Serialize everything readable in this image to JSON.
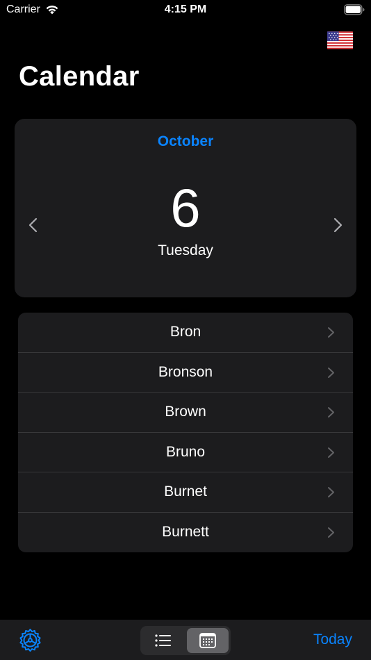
{
  "status_bar": {
    "carrier": "Carrier",
    "time": "4:15 PM"
  },
  "header": {
    "title": "Calendar",
    "flag_icon": "us-flag-icon"
  },
  "date_card": {
    "month": "October",
    "day": "6",
    "weekday": "Tuesday",
    "prev_icon": "chevron-left-icon",
    "next_icon": "chevron-right-icon"
  },
  "names": [
    {
      "label": "Bron"
    },
    {
      "label": "Bronson"
    },
    {
      "label": "Brown"
    },
    {
      "label": "Bruno"
    },
    {
      "label": "Burnet"
    },
    {
      "label": "Burnett"
    }
  ],
  "toolbar": {
    "settings_icon": "gear-icon",
    "view_modes": [
      {
        "icon": "list-icon",
        "selected": false
      },
      {
        "icon": "calendar-icon",
        "selected": true
      }
    ],
    "today_label": "Today"
  },
  "colors": {
    "accent": "#0a84ff",
    "background": "#000000",
    "card": "#1c1c1e",
    "separator": "#38383a"
  }
}
